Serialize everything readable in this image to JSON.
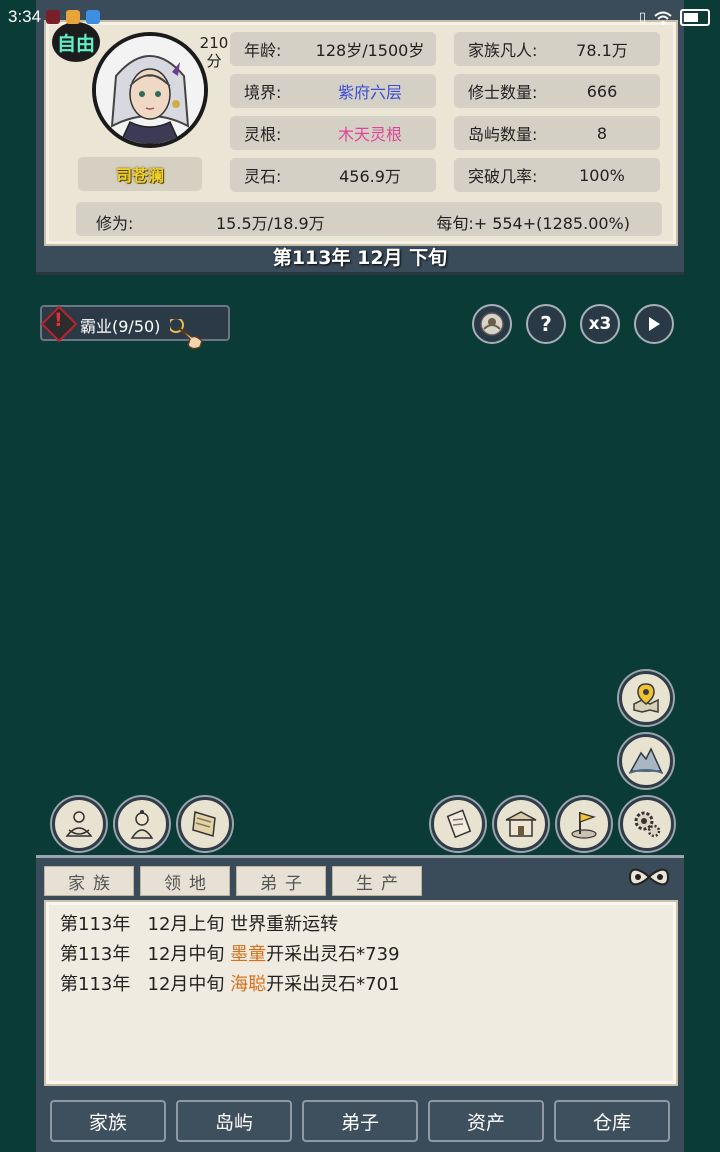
{
  "status_bar": {
    "time": "3:34",
    "icons": [
      "app-notify-icon",
      "weibo-icon",
      "cloud-icon",
      "vibrate-icon",
      "wifi-icon",
      "battery-icon"
    ]
  },
  "profile": {
    "badge": "自由",
    "score_value": "210",
    "score_unit": "分",
    "name": "司苍澜"
  },
  "stats": {
    "age_label": "年龄:",
    "age_value": "128岁/1500岁",
    "realm_label": "境界:",
    "realm_value": "紫府六层",
    "root_label": "灵根:",
    "root_value": "木天灵根",
    "stone_label": "灵石:",
    "stone_value": "456.9万",
    "mortals_label": "家族凡人:",
    "mortals_value": "78.1万",
    "cultivators_label": "修士数量:",
    "cultivators_value": "666",
    "islands_label": "岛屿数量:",
    "islands_value": "8",
    "breakthrough_label": "突破几率:",
    "breakthrough_value": "100%",
    "cultivation_label": "修为:",
    "cultivation_value": "15.5万/18.9万",
    "per_period": "每旬:+ 554+(1285.00%)"
  },
  "colors": {
    "realm": "#3a4fd6",
    "root": "#e0459a",
    "highlight": "#d8701a",
    "background": "#0b3b36"
  },
  "date": "第113年 12月 下旬",
  "quest": {
    "label": "霸业(9/50)"
  },
  "controls": {
    "speed_label": "x3"
  },
  "log_tabs": [
    "家族",
    "领地",
    "弟子",
    "生产"
  ],
  "log": [
    {
      "year": "第113年",
      "period": "12月上旬",
      "name": "",
      "text": "世界重新运转"
    },
    {
      "year": "第113年",
      "period": "12月中旬",
      "name": "墨童",
      "text": "开采出灵石*739"
    },
    {
      "year": "第113年",
      "period": "12月中旬",
      "name": "海聪",
      "text": "开采出灵石*701"
    }
  ],
  "bottom_nav": [
    "家族",
    "岛屿",
    "弟子",
    "资产",
    "仓库"
  ]
}
